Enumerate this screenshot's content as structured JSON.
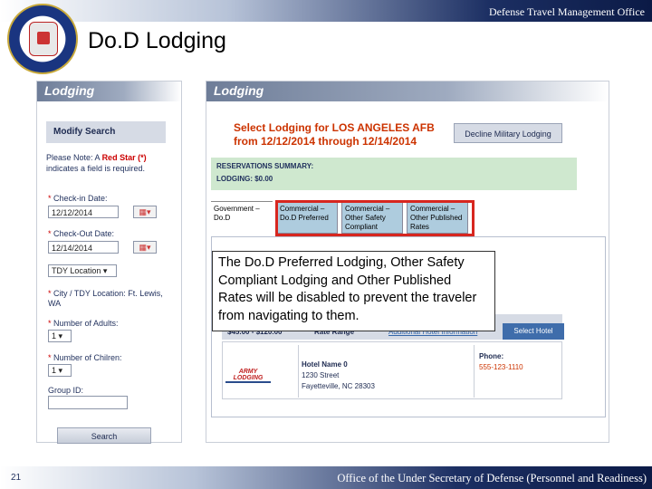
{
  "header": {
    "office": "Defense Travel Management Office",
    "title": "Do.D Lodging"
  },
  "left_panel": {
    "tab_label": "Lodging",
    "modify_search": "Modify Search",
    "note_prefix": "Please Note: A",
    "note_red": "Red Star (*)",
    "note_suffix": "indicates a field is required.",
    "checkin_label": "Check-in Date:",
    "checkin_value": "12/12/2014",
    "checkout_label": "Check-Out Date:",
    "checkout_value": "12/14/2014",
    "location_type": "TDY Location",
    "city_label": "City / TDY Location: Ft. Lewis, WA",
    "adults_label": "Number of Adults:",
    "adults_value": "1",
    "children_label": "Number of Chilren:",
    "children_value": "1",
    "group_label": "Group ID:",
    "search_button": "Search"
  },
  "right_panel": {
    "tab_label": "Lodging",
    "select_title_line1": "Select Lodging for LOS ANGELES AFB",
    "select_title_line2": "from 12/12/2014 through 12/14/2014",
    "decline_button": "Decline Military Lodging",
    "summary_title": "RESERVATIONS SUMMARY:",
    "summary_lodging": "LODGING:  $0.00",
    "tabs": [
      {
        "label": "Government – Do.D"
      },
      {
        "label": "Commercial – Do.D Preferred"
      },
      {
        "label": "Commercial – Other Safety Compliant"
      },
      {
        "label": "Commercial – Other Published Rates"
      }
    ],
    "rate": "$45.00 - $120.00",
    "rate_range_label": "Rate Range",
    "additional_info": "Additional Hotel Information",
    "select_hotel": "Select Hotel",
    "hotel_logo_text": "ARMY LODGING",
    "hotel_name": "Hotel Name 0",
    "hotel_street": "1230 Street",
    "hotel_city": "Fayetteville, NC 28303",
    "phone_label": "Phone:",
    "phone_value": "555-123-1110"
  },
  "callout": "The Do.D Preferred Lodging, Other Safety Compliant Lodging and Other Published Rates will be disabled to prevent the traveler from navigating to them.",
  "footer": {
    "page_number": "21",
    "office": "Office of the Under Secretary of Defense (Personnel and Readiness)"
  },
  "colors": {
    "accent_red": "#d7261f",
    "navy": "#1c2f63",
    "summary_green": "#cfe8cf",
    "disabled_tab": "#aeccde"
  }
}
